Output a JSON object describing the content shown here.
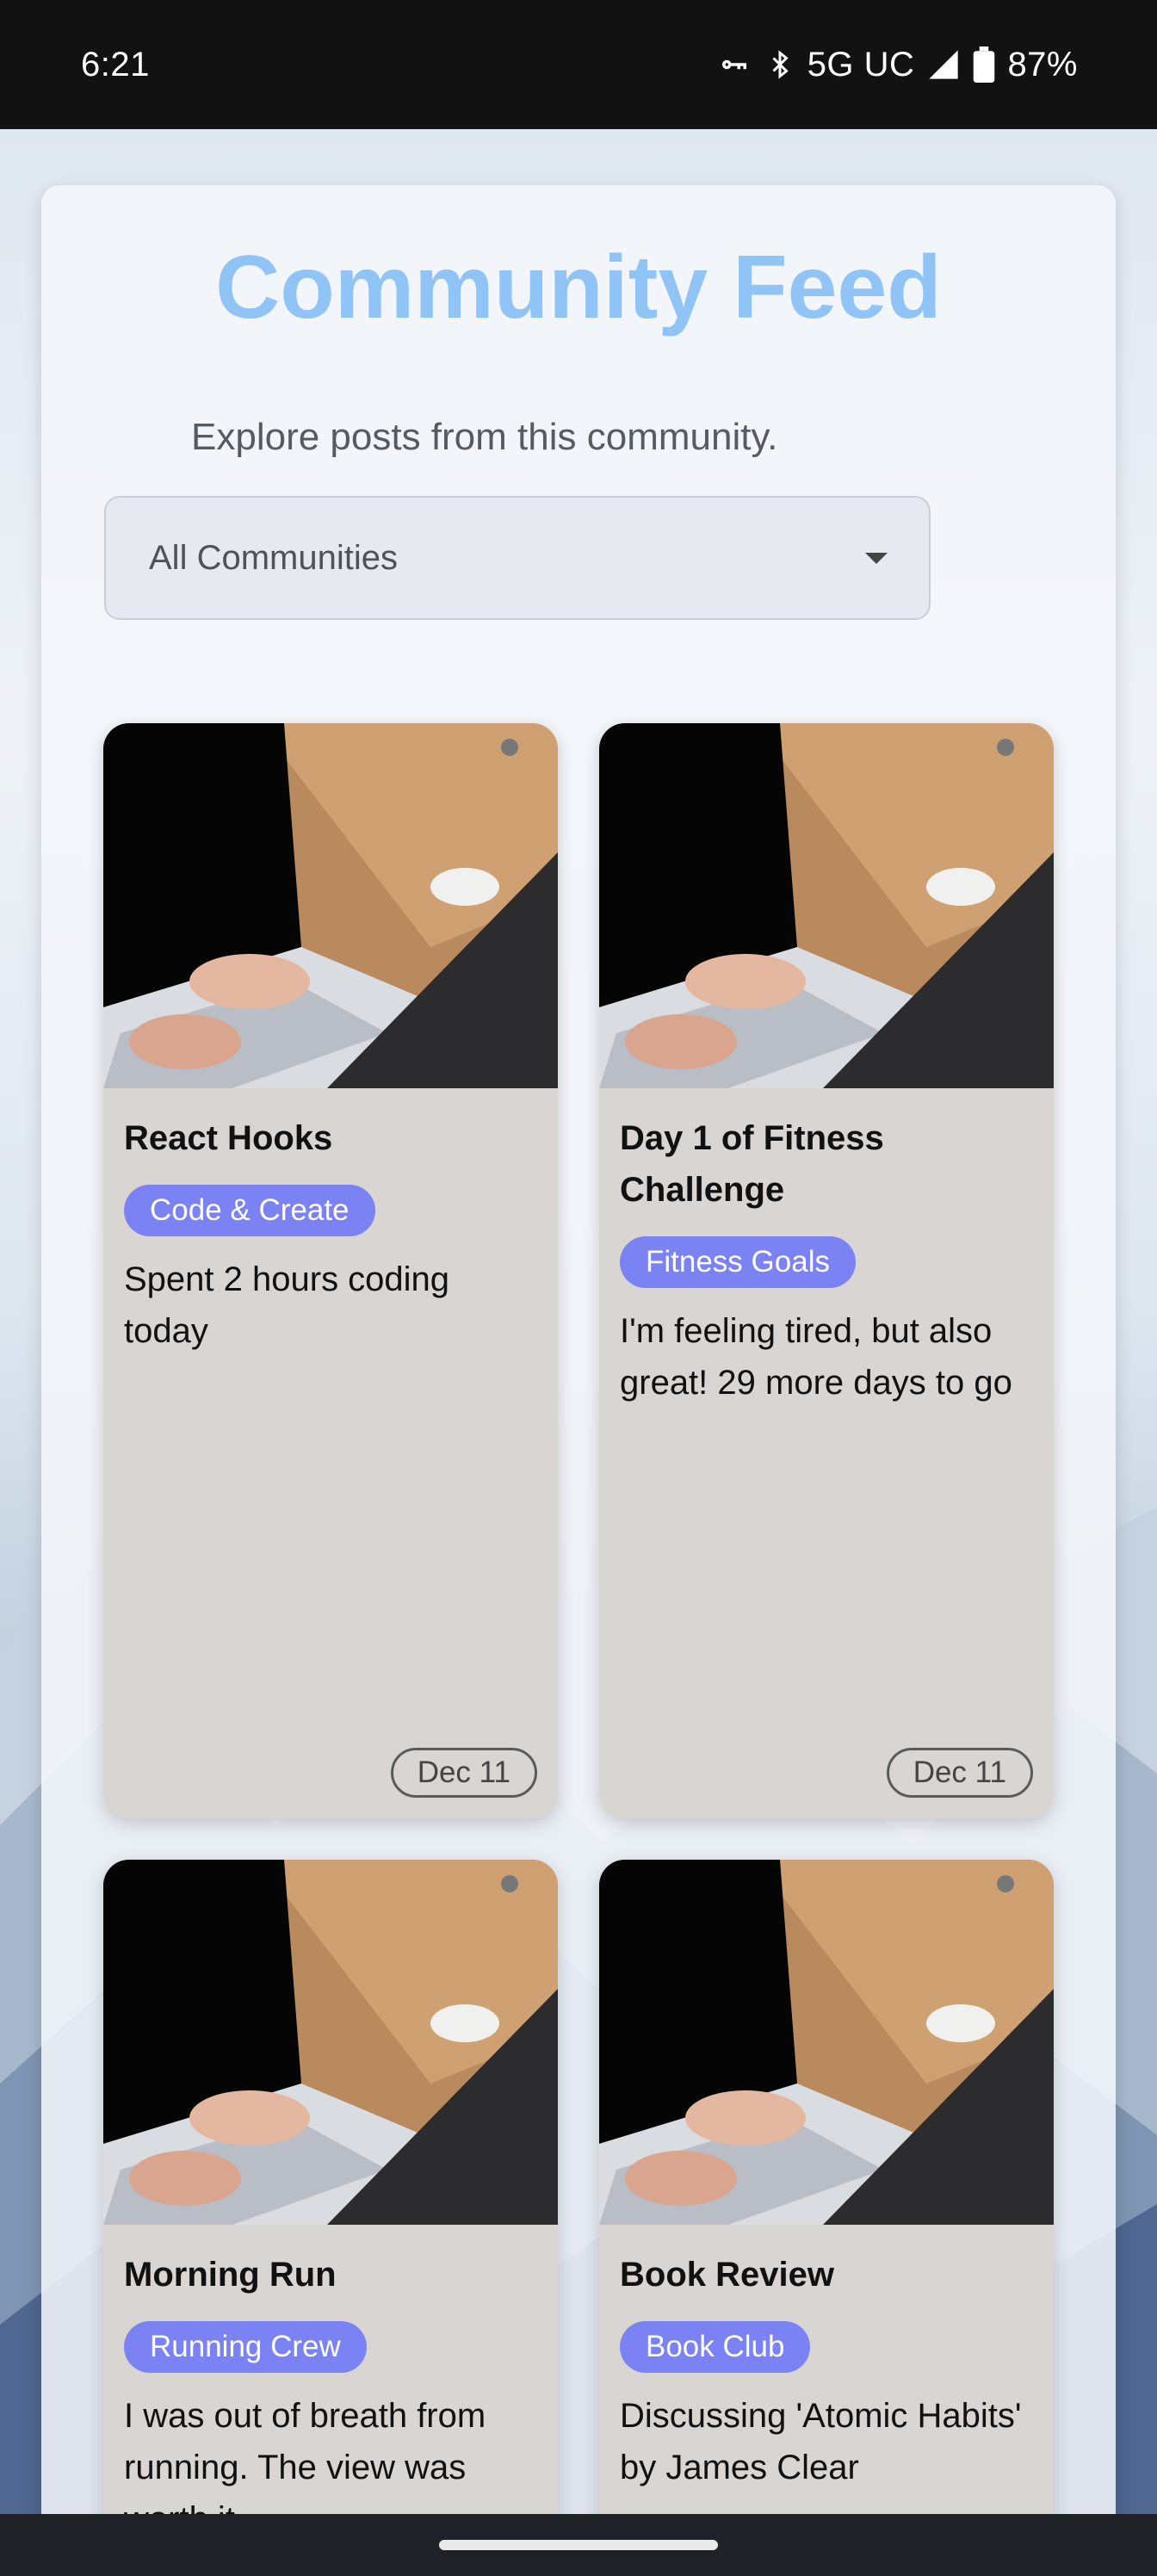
{
  "status_bar": {
    "time": "6:21",
    "network": "5G UC",
    "battery": "87%",
    "icons": [
      "vpn-key-icon",
      "bluetooth-icon",
      "signal-icon",
      "battery-icon"
    ]
  },
  "header": {
    "title": "Community Feed",
    "subtitle": "Explore posts from this community."
  },
  "filter": {
    "selected": "All Communities"
  },
  "colors": {
    "title": "#90c4f7",
    "tag": "#7b82f4",
    "card": "#d8d5d3"
  },
  "posts": [
    {
      "title": "React Hooks",
      "community": "Code & Create",
      "text": "Spent 2 hours coding today",
      "date": "Dec 11"
    },
    {
      "title": "Day 1 of Fitness Challenge",
      "community": "Fitness Goals",
      "text": "I'm feeling tired, but also great! 29 more days to go",
      "date": "Dec 11"
    },
    {
      "title": "Morning Run",
      "community": "Running Crew",
      "text": "I was out of breath from running. The view was worth it"
    },
    {
      "title": "Book Review",
      "community": "Book Club",
      "text": "Discussing 'Atomic Habits' by James Clear"
    }
  ]
}
